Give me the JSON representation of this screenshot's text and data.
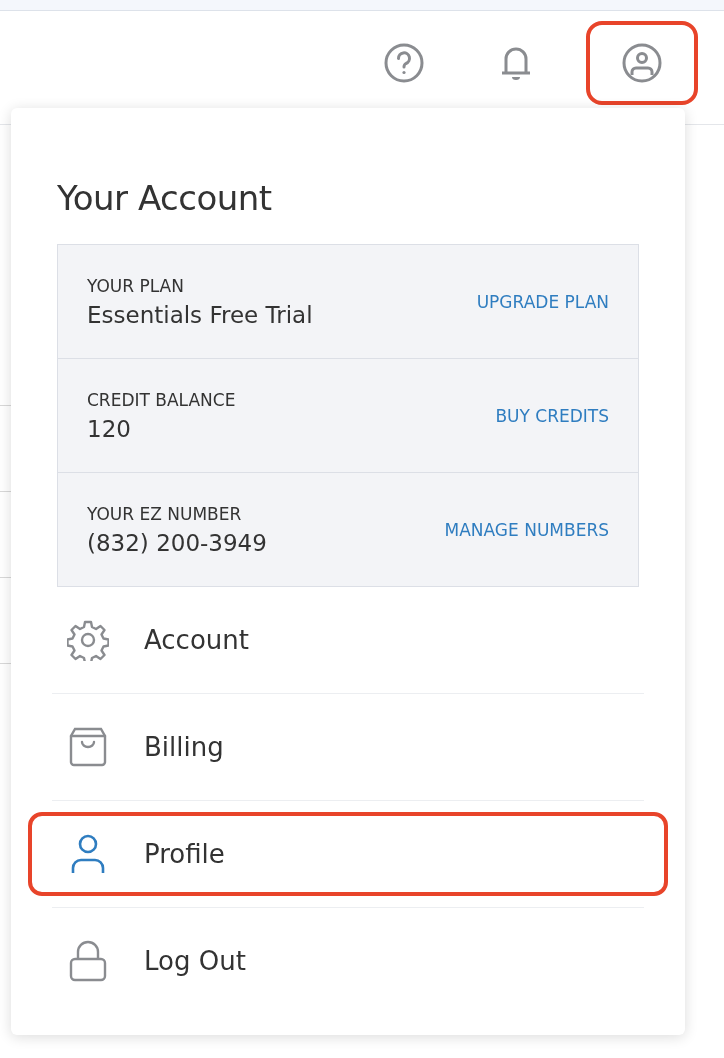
{
  "header": {
    "icons": [
      {
        "kind": "help",
        "highlighted": false
      },
      {
        "kind": "bell",
        "highlighted": false
      },
      {
        "kind": "account",
        "highlighted": true
      }
    ]
  },
  "account_menu": {
    "title": "Your Account",
    "details": [
      {
        "label": "YOUR PLAN",
        "value": "Essentials Free Trial",
        "action": "UPGRADE PLAN"
      },
      {
        "label": "CREDIT BALANCE",
        "value": "120",
        "action": "BUY CREDITS"
      },
      {
        "label": "YOUR EZ NUMBER",
        "value": "(832) 200-3949",
        "action": "MANAGE NUMBERS"
      }
    ],
    "items": [
      {
        "kind": "gear",
        "label": "Account",
        "highlighted": false
      },
      {
        "kind": "bag",
        "label": "Billing",
        "highlighted": false
      },
      {
        "kind": "person",
        "label": "Profile",
        "highlighted": true
      },
      {
        "kind": "lock",
        "label": "Log Out",
        "highlighted": false
      }
    ]
  }
}
